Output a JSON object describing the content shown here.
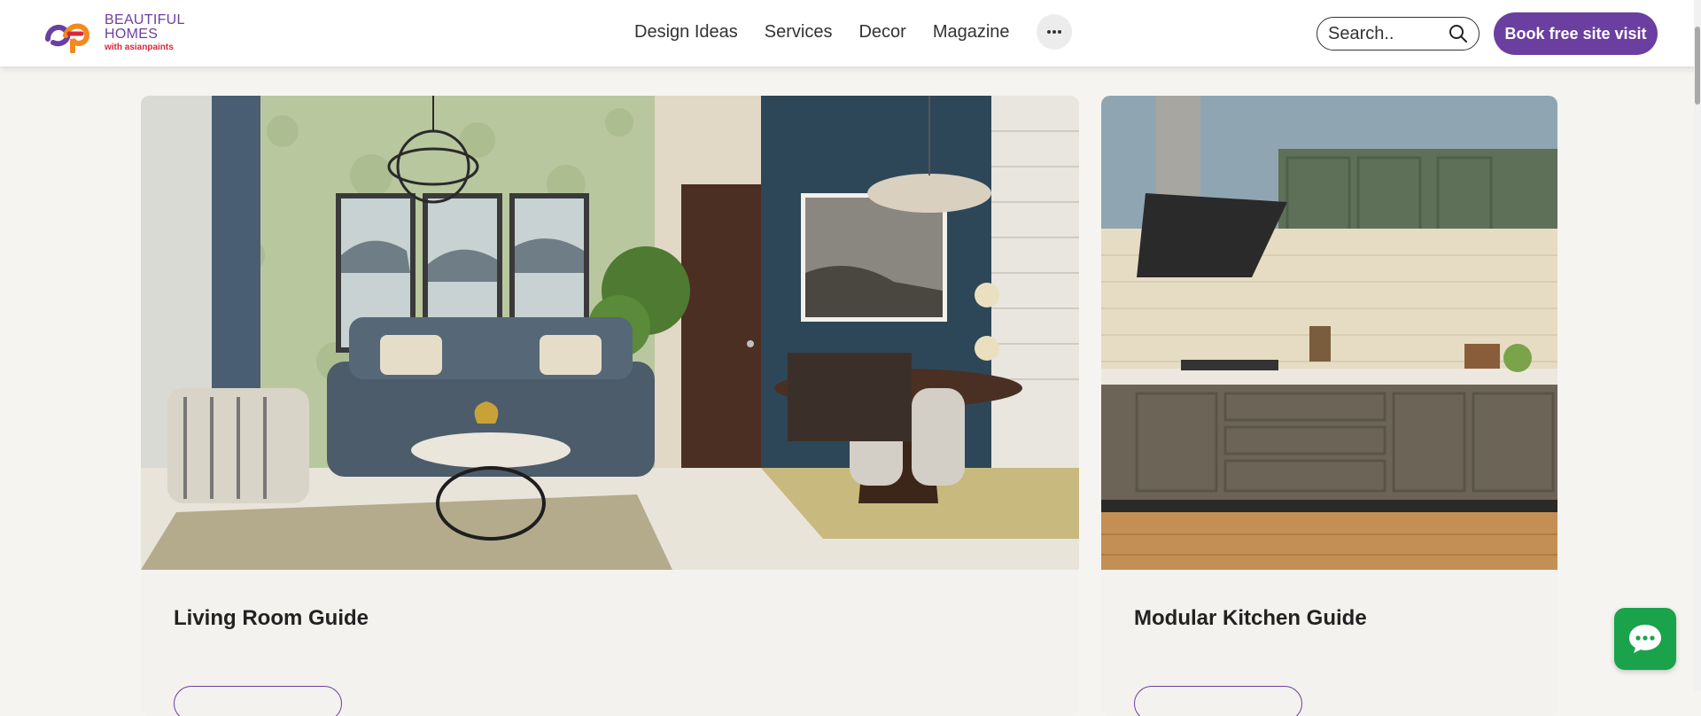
{
  "header": {
    "logo": {
      "line1": "BEAUTIFUL",
      "line2": "HOMES",
      "line3": "with asianpaints",
      "brand_colors": [
        "#6b3fa0",
        "#d6283a",
        "#f28a1e"
      ]
    },
    "nav": [
      {
        "label": "Design Ideas"
      },
      {
        "label": "Services"
      },
      {
        "label": "Decor"
      },
      {
        "label": "Magazine"
      }
    ],
    "more_icon": "ellipsis-icon",
    "search": {
      "placeholder": "Search..",
      "icon": "search-icon"
    },
    "cta_label": "Book free site visit"
  },
  "cards": [
    {
      "title": "Living Room Guide",
      "image": "living room interior with grey sofa, wallpaper and dining area"
    },
    {
      "title": "Modular Kitchen Guide",
      "image": "modular kitchen with grey cabinets and chimney"
    }
  ],
  "chat": {
    "icon": "chat-bubble-icon"
  },
  "colors": {
    "accent": "#6b3fa0",
    "chat": "#1aa34a",
    "card_bg": "#f3f2ee"
  }
}
